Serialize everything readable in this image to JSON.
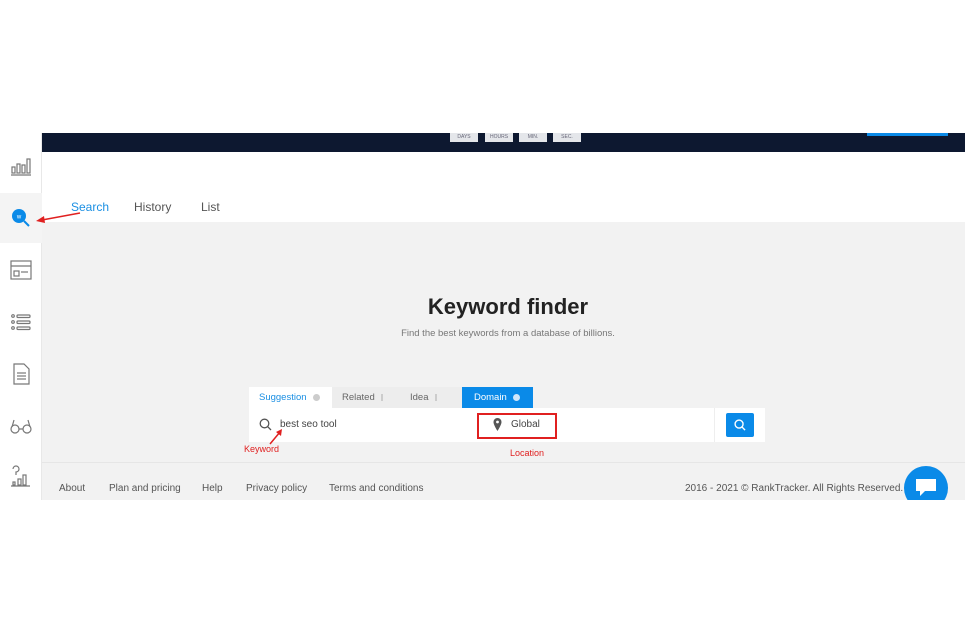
{
  "countdown": [
    "DAYS",
    "HOURS",
    "MIN.",
    "SEC."
  ],
  "nav_tabs": [
    {
      "label": "Search",
      "active": true
    },
    {
      "label": "History"
    },
    {
      "label": "List"
    }
  ],
  "sidebar_icons": [
    "bar-chart-icon",
    "keyword-search-icon",
    "browser-window-icon",
    "list-icon",
    "document-icon",
    "glasses-icon",
    "question-chart-icon"
  ],
  "hero": {
    "title": "Keyword finder",
    "subtitle": "Find the best keywords from a database of billions."
  },
  "search_tabs": [
    {
      "label": "Suggestion",
      "active": true
    },
    {
      "label": "Related"
    },
    {
      "label": "Idea"
    },
    {
      "label": "Domain",
      "selected": true
    }
  ],
  "search": {
    "keyword_value": "best seo tool",
    "location_value": "Global"
  },
  "annotations": {
    "keyword": "Keyword",
    "location": "Location"
  },
  "footer": {
    "links": [
      "About",
      "Plan and pricing",
      "Help",
      "Privacy policy",
      "Terms and conditions"
    ],
    "copyright": "2016 - 2021 © RankTracker. All Rights Reserved."
  },
  "colors": {
    "accent": "#0a8ae8",
    "header": "#0d1830",
    "annotation": "#e02020"
  }
}
